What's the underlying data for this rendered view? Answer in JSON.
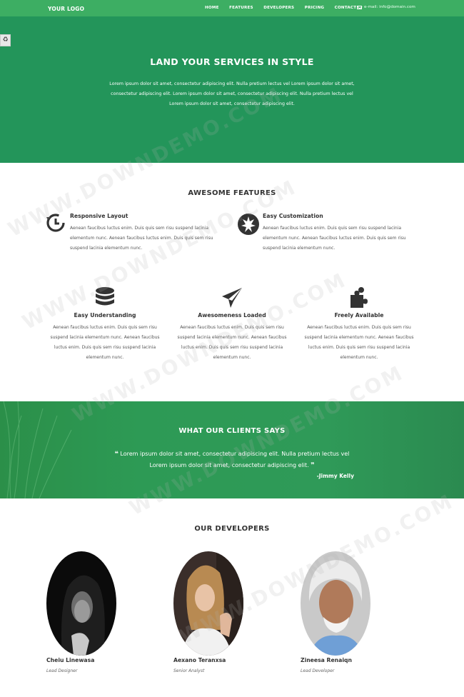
{
  "nav": {
    "logo": "YOUR LOGO",
    "items": [
      "HOME",
      "FEATURES",
      "DEVELOPERS",
      "PRICING",
      "CONTACT"
    ],
    "email": "e-mail: info@domain.com"
  },
  "hero": {
    "title": "LAND YOUR SERVICES IN STYLE",
    "text": "Lorem ipsum dolor sit amet, consectetur adipiscing elit. Nulla pretium lectus vel Lorem ipsum dolor sit amet, consectetur adipiscing elit. Lorem ipsum dolor sit amet, consectetur adipiscing elit. Nulla pretium lectus vel Lorem ipsum dolor sit amet, consectetur adipiscing elit."
  },
  "features": {
    "title": "AWESOME FEATURES",
    "items": [
      {
        "title": "Responsive Layout",
        "text": "Aenean faucibus luctus enim. Duis quis sem risu suspend lacinia elementum nunc. Aenean faucibus luctus enim. Duis quis sem risu suspend lacinia elementum nunc.",
        "icon": "history-icon"
      },
      {
        "title": "Easy Customization",
        "text": "Aenean faucibus luctus enim. Duis quis sem risu suspend lacinia elementum nunc. Aenean faucibus luctus enim. Duis quis sem risu suspend lacinia elementum nunc.",
        "icon": "rebel-icon"
      },
      {
        "title": "Easy Understanding",
        "text": "Aenean faucibus luctus enim. Duis quis sem risu suspend lacinia elementum nunc. Aenean faucibus luctus enim. Duis quis sem risu suspend lacinia elementum nunc.",
        "icon": "database-icon"
      },
      {
        "title": "Awesomeness Loaded",
        "text": "Aenean faucibus luctus enim. Duis quis sem risu suspend lacinia elementum nunc. Aenean faucibus luctus enim. Duis quis sem risu suspend lacinia elementum nunc.",
        "icon": "paper-plane-icon"
      },
      {
        "title": "Freely Available",
        "text": "Aenean faucibus luctus enim. Duis quis sem risu suspend lacinia elementum nunc. Aenean faucibus luctus enim. Duis quis sem risu suspend lacinia elementum nunc.",
        "icon": "puzzle-icon"
      }
    ]
  },
  "testimonial": {
    "title": "WHAT OUR CLIENTS SAYS",
    "quote": "Lorem ipsum dolor sit amet, consectetur adipiscing elit. Nulla pretium lectus vel Lorem ipsum dolor sit amet, consectetur adipiscing elit.",
    "author": "-Jimmy Kelly"
  },
  "developers": {
    "title": "OUR DEVELOPERS",
    "people": [
      {
        "name": "Cheiu Linewasa",
        "role": "Lead Designer"
      },
      {
        "name": "Aexano Teranxsa",
        "role": "Senior Analyst"
      },
      {
        "name": "Zineesa Renaiqn",
        "role": "Lead Developer"
      }
    ]
  },
  "watermark": "WWW.DOWNDEMO.COM",
  "colors": {
    "nav": "#3dae63",
    "hero": "#23955a",
    "testimonial": "#2d9a55"
  }
}
